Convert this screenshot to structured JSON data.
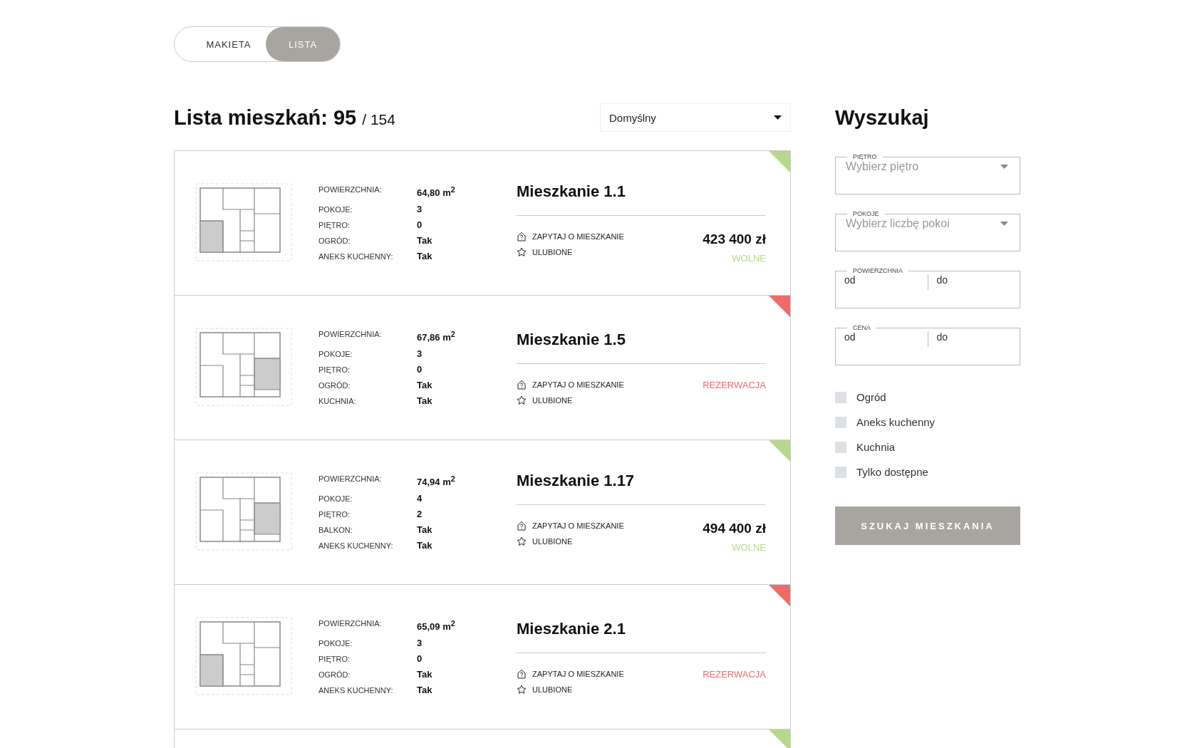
{
  "view_toggle": [
    {
      "label": "MAKIETA",
      "selected": false
    },
    {
      "label": "LISTA",
      "selected": true
    }
  ],
  "list_header": {
    "title": "Lista mieszkań:",
    "count": "95",
    "total": "/ 154"
  },
  "sort": {
    "value": "Domyślny"
  },
  "apartments": [
    {
      "name": "Mieszkanie 1.1",
      "color": "#b5d98a",
      "status_label": "WOLNE",
      "price": "423 400 zł",
      "kind": "west",
      "inquire": "ZAPYTAJ O MIESZKANIE",
      "favorite": "ULUBIONE",
      "specs": [
        {
          "label": "POWIERZCHNIA:",
          "value": "64,80  m$^{2}$"
        },
        {
          "label": "POKOJE:",
          "value": "3"
        },
        {
          "label": "PIĘTRO:",
          "value": "0"
        },
        {
          "label": "OGRÓD:",
          "value": "Tak"
        },
        {
          "label": "ANEKS KUCHENNY:",
          "value": "Tak"
        }
      ]
    },
    {
      "name": "Mieszkanie 1.5",
      "color": "#ef6b6b",
      "status_label": "REZERWACJA",
      "kind": "east",
      "inquire": "ZAPYTAJ O MIESZKANIE",
      "favorite": "ULUBIONE",
      "specs": [
        {
          "label": "POWIERZCHNIA:",
          "value": "67,86  m$^{2}$"
        },
        {
          "label": "POKOJE:",
          "value": "3"
        },
        {
          "label": "PIĘTRO:",
          "value": "0"
        },
        {
          "label": "OGRÓD:",
          "value": "Tak"
        },
        {
          "label": "KUCHNIA:",
          "value": "Tak"
        }
      ]
    },
    {
      "name": "Mieszkanie 1.17",
      "color": "#b5d98a",
      "status_label": "WOLNE",
      "price": "494 400 zł",
      "kind": "east",
      "inquire": "ZAPYTAJ O MIESZKANIE",
      "favorite": "ULUBIONE",
      "specs": [
        {
          "label": "POWIERZCHNIA:",
          "value": "74,94  m$^{2}$"
        },
        {
          "label": "POKOJE:",
          "value": "4"
        },
        {
          "label": "PIĘTRO:",
          "value": "2"
        },
        {
          "label": "BALKON:",
          "value": "Tak"
        },
        {
          "label": "ANEKS KUCHENNY:",
          "value": "Tak"
        }
      ]
    },
    {
      "name": "Mieszkanie 2.1",
      "color": "#ef6b6b",
      "status_label": "REZERWACJA",
      "kind": "west",
      "inquire": "ZAPYTAJ O MIESZKANIE",
      "favorite": "ULUBIONE",
      "specs": [
        {
          "label": "POWIERZCHNIA:",
          "value": "65,09  m$^{2}$"
        },
        {
          "label": "POKOJE:",
          "value": "3"
        },
        {
          "label": "PIĘTRO:",
          "value": "0"
        },
        {
          "label": "OGRÓD:",
          "value": "Tak"
        },
        {
          "label": "ANEKS KUCHENNY:",
          "value": "Tak"
        }
      ]
    }
  ],
  "next_apartment": {
    "color": "#b5d98a"
  },
  "search": {
    "title": "Wyszukaj",
    "selects": [
      {
        "label": "PIĘTRO",
        "placeholder": "Wybierz piętro"
      },
      {
        "label": "POKOJE",
        "placeholder": "Wybierz liczbę pokoi"
      }
    ],
    "ranges": [
      {
        "label": "POWIERZCHNIA",
        "from_placeholder": "od",
        "to_placeholder": "do"
      },
      {
        "label": "CENA",
        "from_placeholder": "od",
        "to_placeholder": "do"
      }
    ],
    "checkboxes": [
      {
        "label": "Ogród",
        "checked": false
      },
      {
        "label": "Aneks kuchenny",
        "checked": false
      },
      {
        "label": "Kuchnia",
        "checked": false
      },
      {
        "label": "Tylko dostępne",
        "checked": false
      }
    ],
    "button": "SZUKAJ MIESZKANIA"
  }
}
